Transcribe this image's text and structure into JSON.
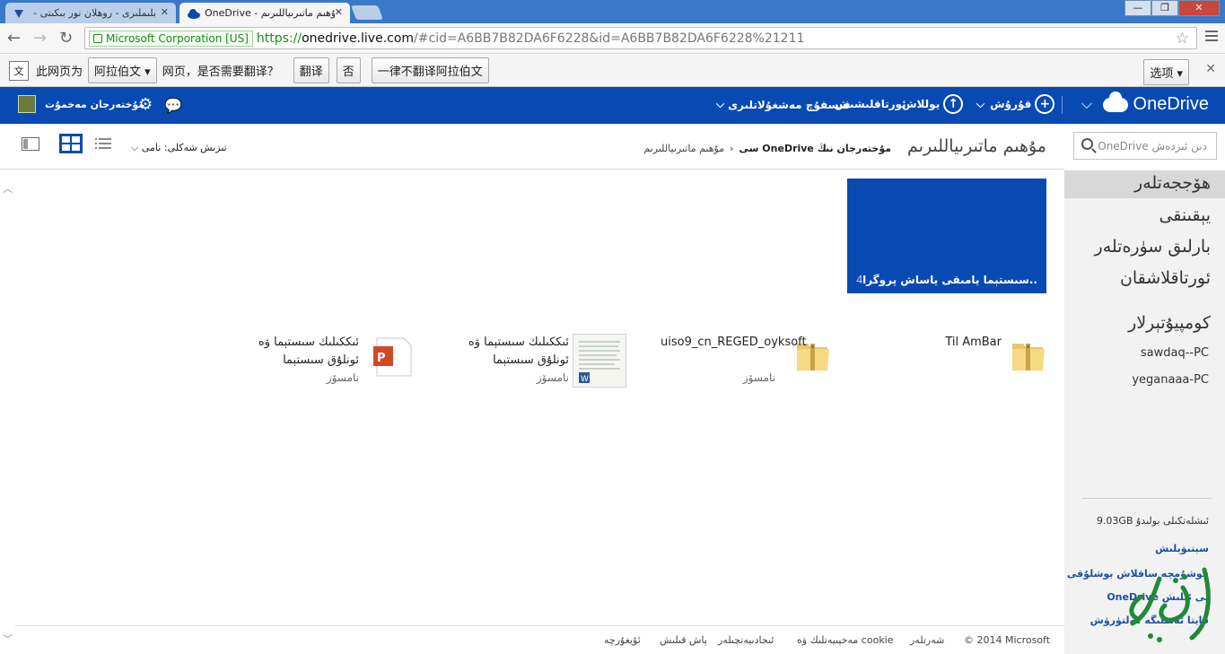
{
  "browser": {
    "tabs": [
      {
        "title": "بلىملىرى - روھلان نور بىكىتى -",
        "active": false
      },
      {
        "title": "OneDrive - مۇھىم ماتىرىياللىرىم",
        "active": true
      }
    ],
    "window_buttons": {
      "minimize": "—",
      "maximize": "❐",
      "close": "✕"
    },
    "ev_label": "Microsoft Corporation [US]",
    "url_scheme": "https://",
    "url_host": "onedrive.live.com",
    "url_rest": "/#cid=A6BB7B82DA6F6228&id=A6BB7B82DA6F6228%21211"
  },
  "translate_bar": {
    "prefix": "此网页为",
    "language": "阿拉伯文",
    "question": "网页，是否需要翻译？",
    "translate_button": "翻译",
    "no_button": "否",
    "never_button": "一律不翻译阿拉伯文",
    "options_button": "选项"
  },
  "header": {
    "logo": "OneDrive",
    "new": "قۇرۇش",
    "upload": "يوللاش",
    "sync": "ئورتاقلىشىش",
    "manage": "قىسقۇچ مەشغۇلاتلىرى",
    "user_name": "مۇختەرجان مەخمۇت"
  },
  "toolbar": {
    "sort_label": "تىزىش شەكلى: نامى",
    "page_title": "مۇھىم ماتىرىياللىرىم",
    "breadcrumb_root": "مۇختەرجان نىڭ OneDrive سى",
    "breadcrumb_current": "مۇھىم ماتىرىياللىرىم",
    "search_placeholder": "OneDrive دىن ئىزدەش"
  },
  "nav": {
    "items": [
      "ھۆججەتلەر",
      "يېقىنقى",
      "بارلىق سۈرەتلەر",
      "ئورتاقلاشقان"
    ],
    "pcs_heading": "كومپيۇتېرلار",
    "pcs": [
      "sawdaq--PC",
      "yeganaaa-PC"
    ],
    "storage": "9.03GB ئىشلەتكىلى بولىدۇ",
    "links": [
      "سېتىۋېلىش",
      "قوشۇمچە ساقلاش بوشلۇقى",
      "OneDrive نى ئېلىش",
      "قايتا ئەسلىگە كەلتۈرۈش"
    ]
  },
  "tile": {
    "name": "سىستېما يامىقى ياساش پروگرا..",
    "count": "4"
  },
  "files": [
    {
      "name": "Til AmBar",
      "type": ""
    },
    {
      "name": "uiso9_cn_REGED_oyksoft",
      "type": "نامسۆز"
    },
    {
      "name": "ئىككىلىك سىستېما ۋە ئونلۇق سىستېما",
      "type": "نامسۆز"
    },
    {
      "name": "ئىككىلىك سىستېما ۋە ئونلۇق سىستېما",
      "type": "نامسۆز"
    }
  ],
  "footer": {
    "copyright": "© 2014 Microsoft",
    "terms": "شەرتلەر",
    "privacy": "مەخپىيەتلىك ۋە cookie",
    "developers": "ئىجادىيەتچىلەر",
    "report": "پاش قىلىش",
    "language": "ئۇيغۇرچە"
  },
  "colors": {
    "brand": "#094ab2",
    "nav_bg": "#f2f2f2",
    "titlebar": "#3a78c9"
  }
}
